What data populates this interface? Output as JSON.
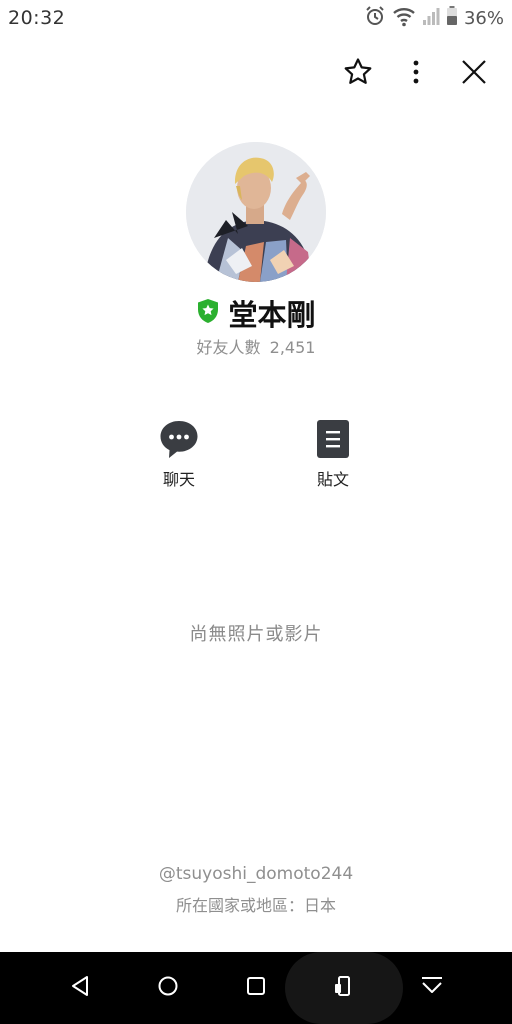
{
  "status_bar": {
    "time": "20:32",
    "battery_percent": "36%",
    "icons": [
      "alarm-icon",
      "wifi-icon",
      "signal-icon",
      "battery-icon"
    ]
  },
  "top_actions": {
    "icons": [
      "star-icon",
      "more-vertical-icon",
      "close-icon"
    ]
  },
  "profile": {
    "name": "堂本剛",
    "verified_badge": "shield-star-icon",
    "friends_label": "好友人數",
    "friends_count": "2,451"
  },
  "actions": [
    {
      "label": "聊天",
      "icon": "chat-bubble-icon"
    },
    {
      "label": "貼文",
      "icon": "post-document-icon"
    }
  ],
  "empty_media_text": "尚無照片或影片",
  "footer": {
    "line_id": "@tsuyoshi_domoto244",
    "country": "所在國家或地區：日本"
  },
  "nav_bar": {
    "icons": [
      "back-icon",
      "home-icon",
      "recents-icon",
      "screen-rotate-icon",
      "hide-nav-icon"
    ]
  },
  "colors": {
    "badge_green": "#2bb02f",
    "nav_background": "#000000",
    "dark_icon": "#3a3d42"
  }
}
